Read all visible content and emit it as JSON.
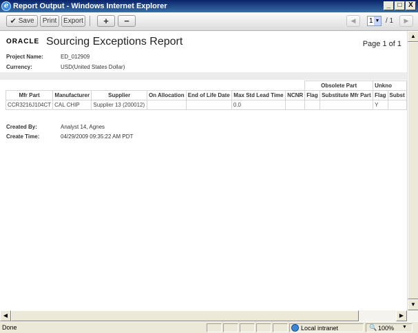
{
  "window": {
    "title": "Report Output - Windows Internet Explorer",
    "icon": "ie-icon",
    "buttons": {
      "minimize": "_",
      "maximize": "□",
      "close": "X"
    }
  },
  "toolbar": {
    "save_label": "Save",
    "print_label": "Print",
    "export_label": "Export",
    "zoom_in_label": "+",
    "zoom_out_label": "−",
    "page_select_value": "1",
    "page_total": "/ 1"
  },
  "report": {
    "logo": "ORACLE",
    "title": "Sourcing Exceptions Report",
    "page_info": "Page 1 of 1",
    "project_label": "Project Name:",
    "project_value": "ED_012909",
    "currency_label": "Currency:",
    "currency_value": "USD(United States Dollar)",
    "group_headers": {
      "obsolete": "Obsolete Part",
      "unknown": "Unkno"
    },
    "columns": [
      "Mfr Part",
      "Manufacturer",
      "Supplier",
      "On Allocation",
      "End of Life Date",
      "Max Std Lead Time",
      "NCNR",
      "Flag",
      "Substitute Mfr Part",
      "Flag",
      "Subst"
    ],
    "row": [
      "CCR3216J104CT",
      "CAL CHIP",
      "Supplier 13 (200012)",
      "",
      "",
      "0.0",
      "",
      "",
      "",
      "Y",
      ""
    ],
    "created_by_label": "Created By:",
    "created_by_value": "Analyst 14, Agnes",
    "create_time_label": "Create Time:",
    "create_time_value": "04/29/2009 09:35:22 AM PDT"
  },
  "statusbar": {
    "status": "Done",
    "zone": "Local intranet",
    "zoom": "100%"
  }
}
